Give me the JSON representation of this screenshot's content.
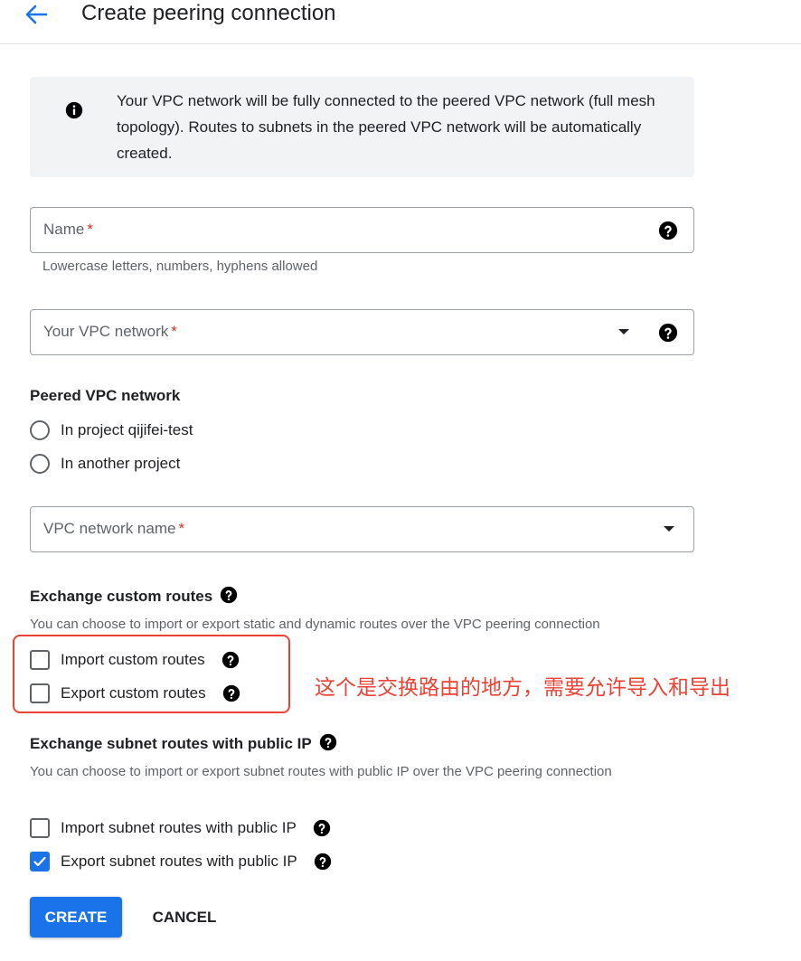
{
  "header": {
    "title": "Create peering connection",
    "back_icon": "arrow-back-icon"
  },
  "info": {
    "icon": "info-icon",
    "text": "Your VPC network will be fully connected to the peered VPC network (full mesh topology). Routes to subnets in the peered VPC network will be automatically created."
  },
  "name_field": {
    "label": "Name",
    "required_mark": "*",
    "hint": "Lowercase letters, numbers, hyphens allowed"
  },
  "vpc_field": {
    "label": "Your VPC network",
    "required_mark": "*"
  },
  "peered": {
    "title": "Peered VPC network",
    "options": [
      "In project qijifei-test",
      "In another project"
    ]
  },
  "vpc_name_field": {
    "label": "VPC network name",
    "required_mark": "*"
  },
  "custom_routes": {
    "title": "Exchange custom routes",
    "desc": "You can choose to import or export static and dynamic routes over the VPC peering connection",
    "import_label": "Import custom routes",
    "export_label": "Export custom routes",
    "import_checked": false,
    "export_checked": false
  },
  "annotation": {
    "text": "这个是交换路由的地方，需要允许导入和导出",
    "color": "#ea4335"
  },
  "subnet_routes": {
    "title": "Exchange subnet routes with public IP",
    "desc": "You can choose to import or export subnet routes with public IP over the VPC peering connection",
    "import_label": "Import subnet routes with public IP",
    "export_label": "Export subnet routes with public IP",
    "import_checked": false,
    "export_checked": true
  },
  "actions": {
    "create": "CREATE",
    "cancel": "CANCEL"
  },
  "colors": {
    "primary": "#1a73e8",
    "required": "#d93025",
    "annotation": "#ea4335"
  }
}
